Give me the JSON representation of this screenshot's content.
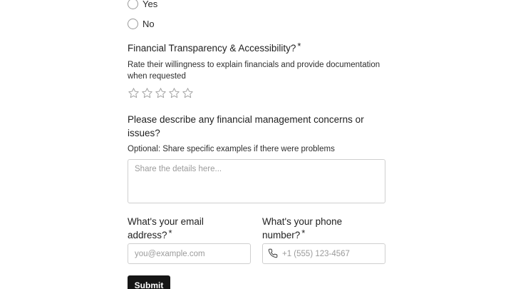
{
  "radio_options": [
    {
      "label": "Yes"
    },
    {
      "label": "No"
    }
  ],
  "transparency": {
    "title": "Financial Transparency & Accessibility?",
    "required_mark": "*",
    "description": "Rate their willingness to explain financials and provide documentation when requested",
    "rating": {
      "value": 0,
      "max": 5
    }
  },
  "concerns": {
    "title": "Please describe any financial management concerns or issues?",
    "description": "Optional: Share specific examples if there were problems",
    "placeholder": "Share the details here..."
  },
  "email": {
    "title": "What's your email address?",
    "required_mark": "*",
    "placeholder": "you@example.com"
  },
  "phone": {
    "title": "What's your phone number?",
    "required_mark": "*",
    "placeholder": "+1 (555) 123-4567",
    "icon": "phone-icon"
  },
  "submit": {
    "label": "Submit"
  }
}
